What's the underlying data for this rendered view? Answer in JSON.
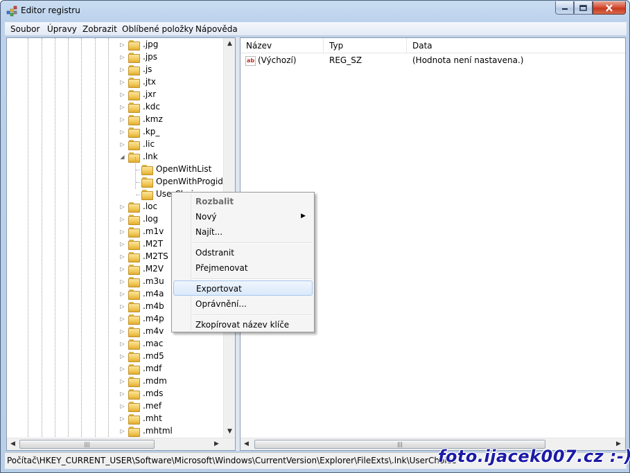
{
  "window": {
    "title": "Editor registru"
  },
  "menubar": [
    "Soubor",
    "Úpravy",
    "Zobrazit",
    "Oblíbené položky",
    "Nápověda"
  ],
  "tree": {
    "items": [
      {
        "label": ".jpg",
        "expander": "▷"
      },
      {
        "label": ".jps",
        "expander": "▷"
      },
      {
        "label": ".js",
        "expander": "▷"
      },
      {
        "label": ".jtx",
        "expander": "▷"
      },
      {
        "label": ".jxr",
        "expander": "▷"
      },
      {
        "label": ".kdc",
        "expander": "▷"
      },
      {
        "label": ".kmz",
        "expander": "▷"
      },
      {
        "label": ".kp_",
        "expander": "▷"
      },
      {
        "label": ".lic",
        "expander": "▷"
      },
      {
        "label": ".lnk",
        "expander": "◢"
      },
      {
        "label": "OpenWithList",
        "expander": ""
      },
      {
        "label": "OpenWithProgids",
        "expander": ""
      },
      {
        "label": "UserChoice",
        "expander": ""
      },
      {
        "label": ".loc",
        "expander": "▷"
      },
      {
        "label": ".log",
        "expander": "▷"
      },
      {
        "label": ".m1v",
        "expander": "▷"
      },
      {
        "label": ".M2T",
        "expander": "▷"
      },
      {
        "label": ".M2TS",
        "expander": "▷"
      },
      {
        "label": ".M2V",
        "expander": "▷"
      },
      {
        "label": ".m3u",
        "expander": "▷"
      },
      {
        "label": ".m4a",
        "expander": "▷"
      },
      {
        "label": ".m4b",
        "expander": "▷"
      },
      {
        "label": ".m4p",
        "expander": "▷"
      },
      {
        "label": ".m4v",
        "expander": "▷"
      },
      {
        "label": ".mac",
        "expander": "▷"
      },
      {
        "label": ".md5",
        "expander": "▷"
      },
      {
        "label": ".mdf",
        "expander": "▷"
      },
      {
        "label": ".mdm",
        "expander": "▷"
      },
      {
        "label": ".mds",
        "expander": "▷"
      },
      {
        "label": ".mef",
        "expander": "▷"
      },
      {
        "label": ".mht",
        "expander": "▷"
      },
      {
        "label": ".mhtml",
        "expander": "▷"
      }
    ]
  },
  "list": {
    "columns": [
      "Název",
      "Typ",
      "Data"
    ],
    "rows": [
      {
        "name": "(Výchozí)",
        "type": "REG_SZ",
        "data": "(Hodnota není nastavena.)",
        "icon": "ab"
      }
    ]
  },
  "context_menu": {
    "items": [
      {
        "label": "Rozbalit"
      },
      {
        "label": "Nový"
      },
      {
        "label": "Najít..."
      },
      {
        "label": "Odstranit"
      },
      {
        "label": "Přejmenovat"
      },
      {
        "label": "Exportovat"
      },
      {
        "label": "Oprávnění..."
      },
      {
        "label": "Zkopírovat název klíče"
      }
    ]
  },
  "statusbar": {
    "path": "Počítač\\HKEY_CURRENT_USER\\Software\\Microsoft\\Windows\\CurrentVersion\\Explorer\\FileExts\\.lnk\\UserChoice"
  },
  "watermark": "foto.ijacek007.cz :-)",
  "scroll": {
    "grip": "|||",
    "up": "▲",
    "down": "▼",
    "left": "◀",
    "right": "▶"
  },
  "window_buttons": {
    "minimize": "—",
    "maximize": "□",
    "close": "X"
  }
}
